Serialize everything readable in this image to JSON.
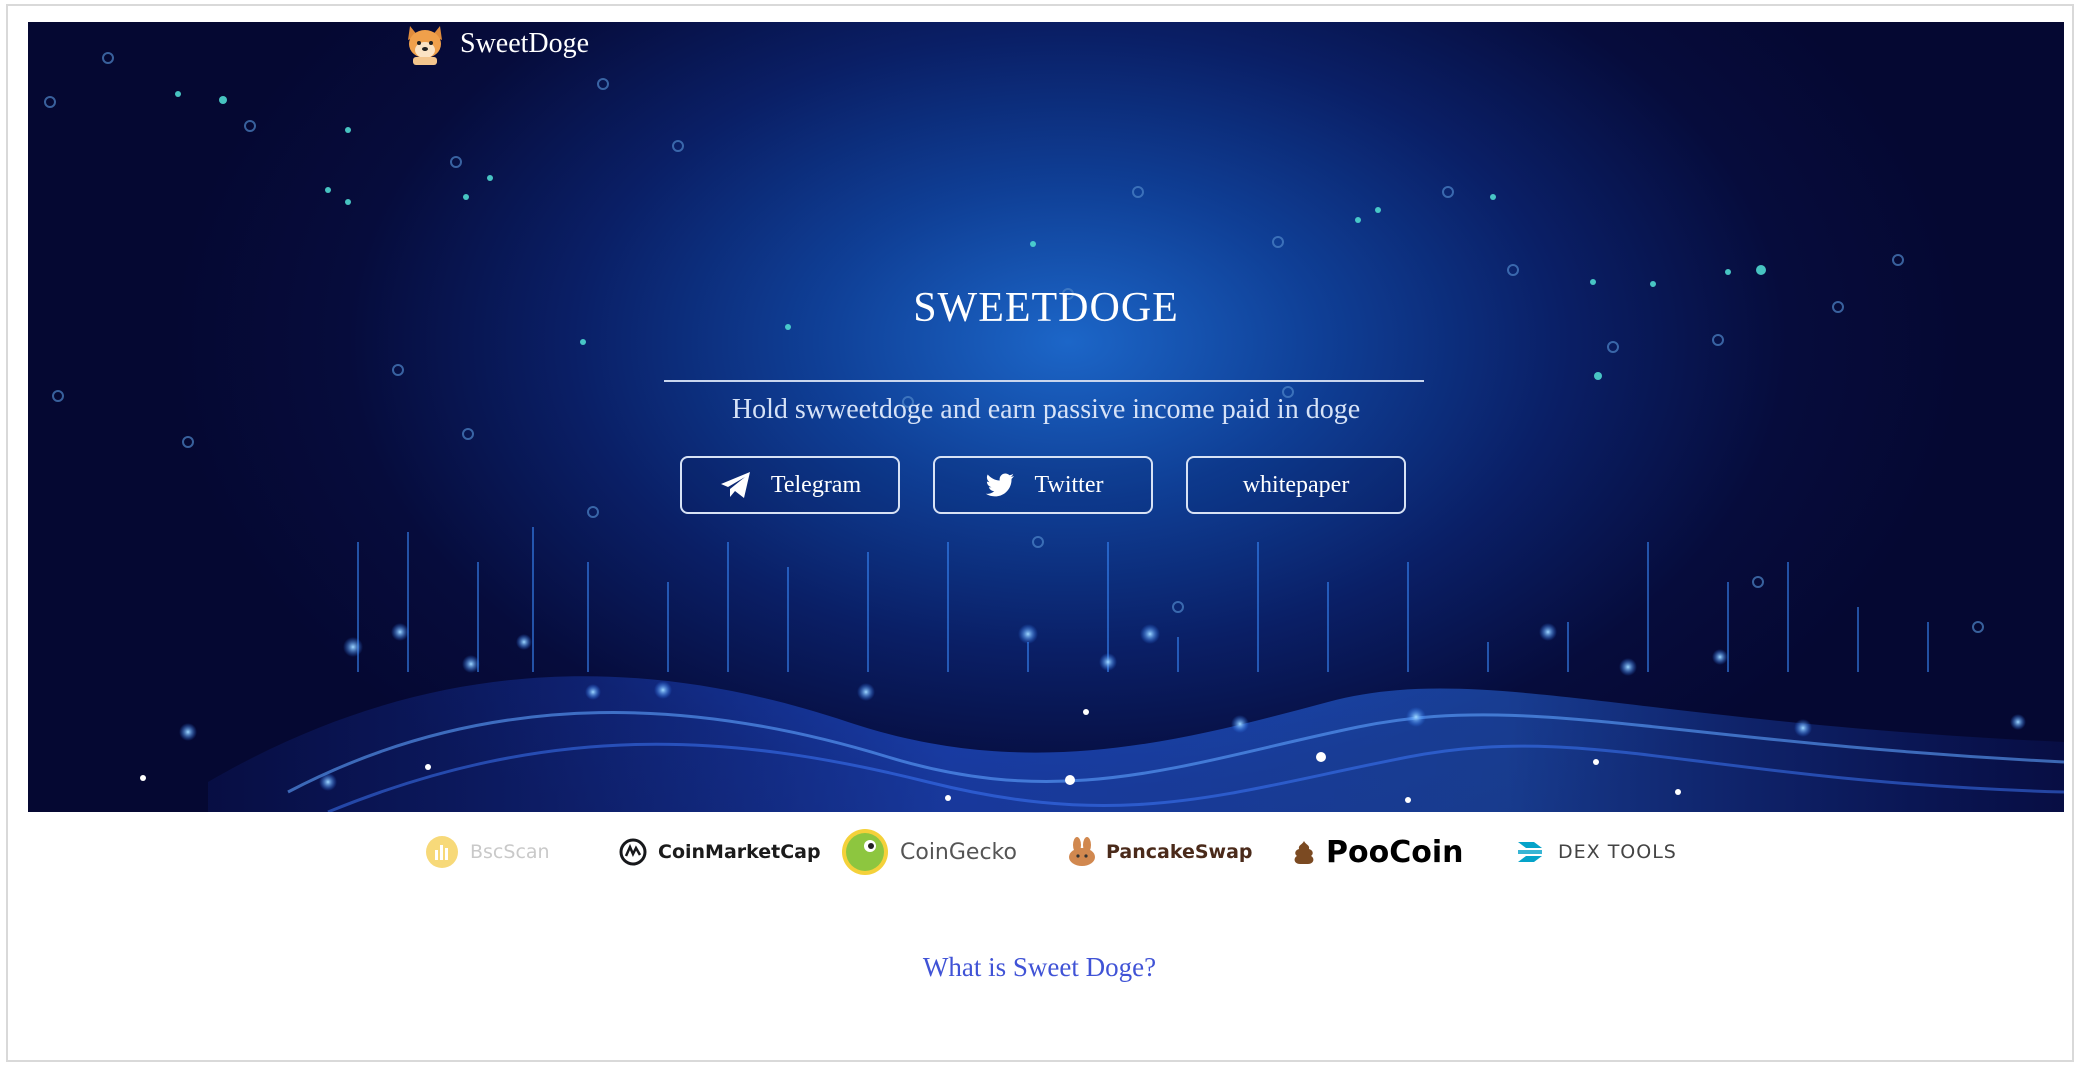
{
  "brand": {
    "name": "SweetDoge",
    "logo_icon": "shiba-dog-icon"
  },
  "hero": {
    "title": "SWEETDOGE",
    "subtitle": "Hold swweetdoge and earn passive income paid in doge",
    "buttons": [
      {
        "label": "Telegram",
        "icon": "telegram-icon"
      },
      {
        "label": "Twitter",
        "icon": "twitter-icon"
      },
      {
        "label": "whitepaper",
        "icon": ""
      }
    ]
  },
  "partners": [
    {
      "label": "BscScan",
      "icon": "bscscan-icon",
      "color": "#f0b90b"
    },
    {
      "label": "CoinMarketCap",
      "icon": "coinmarketcap-icon",
      "color": "#17181b"
    },
    {
      "label": "CoinGecko",
      "icon": "coingecko-icon",
      "color": "#8dc63f"
    },
    {
      "label": "PancakeSwap",
      "icon": "pancakeswap-icon",
      "color": "#d1884f"
    },
    {
      "label": "PooCoin",
      "icon": "poocoin-icon",
      "color": "#000000"
    },
    {
      "label": "DEX TOOLS",
      "icon": "dextools-icon",
      "color": "#05a3c9"
    }
  ],
  "section": {
    "heading": "What is Sweet Doge?"
  },
  "colors": {
    "hero_dark": "#050832",
    "hero_glow": "#1c66c8",
    "heading_blue": "#4053d6"
  }
}
